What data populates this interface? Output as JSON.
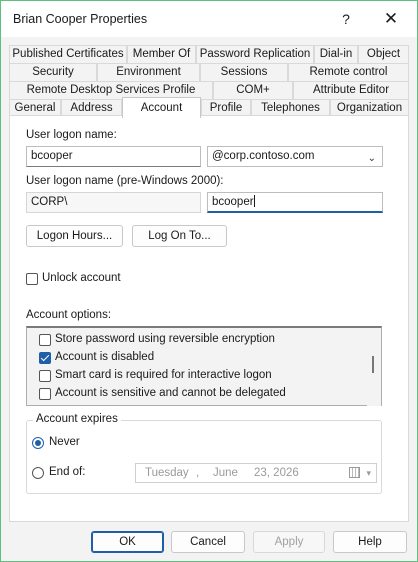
{
  "window": {
    "title": "Brian Cooper Properties",
    "help_glyph": "?",
    "close_glyph": "✕"
  },
  "tabs": {
    "row1": [
      "Published Certificates",
      "Member Of",
      "Password Replication",
      "Dial-in",
      "Object"
    ],
    "row2": [
      "Security",
      "Environment",
      "Sessions",
      "Remote control"
    ],
    "row3": [
      "Remote Desktop Services Profile",
      "COM+",
      "Attribute Editor"
    ],
    "row4": [
      "General",
      "Address",
      "Account",
      "Profile",
      "Telephones",
      "Organization"
    ],
    "active": "Account"
  },
  "account": {
    "logon_name_label": "User logon name:",
    "logon_name_value": "bcooper",
    "domain_suffix": "@corp.contoso.com",
    "pre2000_label": "User logon name (pre-Windows 2000):",
    "pre2000_domain": "CORP\\",
    "pre2000_value": "bcooper",
    "logon_hours_button": "Logon Hours...",
    "log_on_to_button": "Log On To...",
    "unlock_label": "Unlock account",
    "unlock_checked": false,
    "options_label": "Account options:",
    "options": [
      {
        "label": "Store password using reversible encryption",
        "checked": false
      },
      {
        "label": "Account is disabled",
        "checked": true
      },
      {
        "label": "Smart card is required for interactive logon",
        "checked": false
      },
      {
        "label": "Account is sensitive and cannot be delegated",
        "checked": false
      }
    ],
    "expires": {
      "legend": "Account expires",
      "never_label": "Never",
      "end_of_label": "End of:",
      "selected": "Never",
      "date": {
        "weekday": "Tuesday",
        "sep": ",",
        "month": "June",
        "day_year": "23, 2026"
      }
    }
  },
  "footer": {
    "ok": "OK",
    "cancel": "Cancel",
    "apply": "Apply",
    "help": "Help"
  },
  "colors": {
    "accent": "#1f5fa8",
    "window_border": "#5fbf7f"
  }
}
